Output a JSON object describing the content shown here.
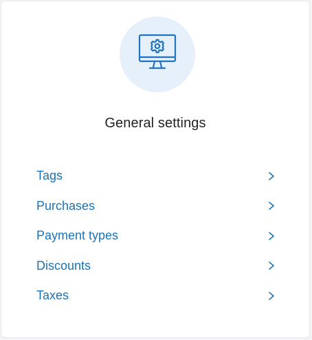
{
  "card": {
    "title": "General settings",
    "icon": "monitor-gear-icon"
  },
  "menu": {
    "items": [
      {
        "label": "Tags",
        "icon": "chevron-right-icon"
      },
      {
        "label": "Purchases",
        "icon": "chevron-right-icon"
      },
      {
        "label": "Payment types",
        "icon": "chevron-right-icon"
      },
      {
        "label": "Discounts",
        "icon": "chevron-right-icon"
      },
      {
        "label": "Taxes",
        "icon": "chevron-right-icon"
      }
    ]
  },
  "colors": {
    "accent": "#1a73b8",
    "icon_bg": "#e5f0fa",
    "title": "#222222"
  }
}
